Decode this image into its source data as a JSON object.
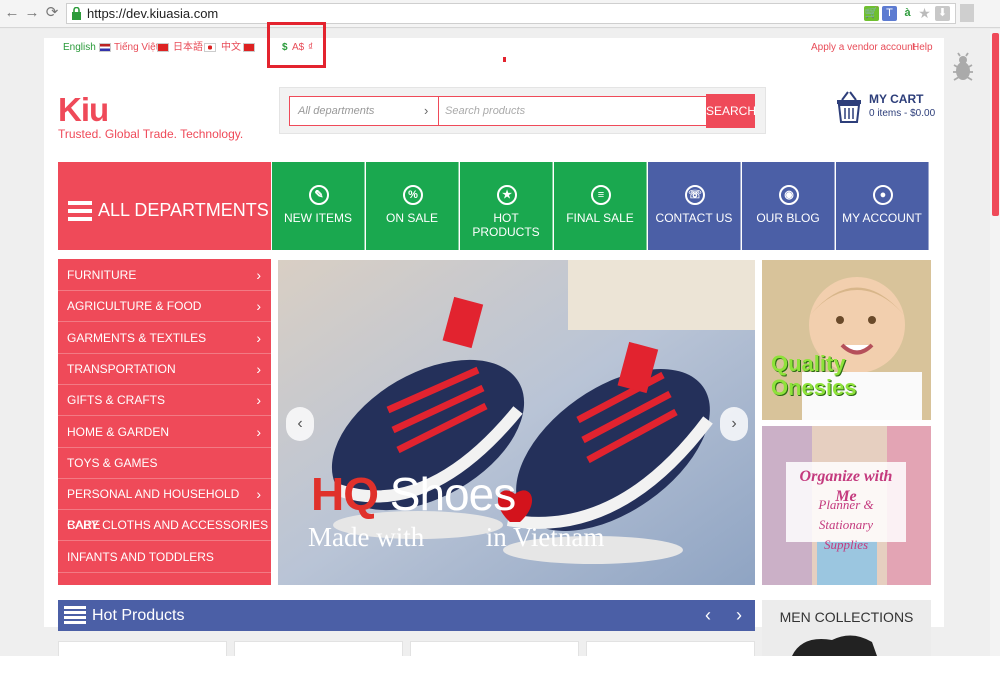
{
  "browser": {
    "url": "https://dev.kiuasia.com"
  },
  "topbar": {
    "languages": [
      {
        "label": "English",
        "color": "#2a9a3a"
      },
      {
        "label": "Tiếng Việt",
        "color": "#e84c58"
      },
      {
        "label": "日本語",
        "color": "#e84c58"
      },
      {
        "label": "中文",
        "color": "#e84c58"
      }
    ],
    "currencies": [
      {
        "label": "$",
        "color": "#2a9a3a"
      },
      {
        "label": "A$",
        "color": "#e84c58"
      },
      {
        "label": "₫",
        "color": "#e84c58"
      }
    ],
    "links": {
      "vendor": "Apply a vendor account",
      "help": "Help"
    }
  },
  "header": {
    "logo": "Kiu",
    "tagline": "Trusted. Global Trade. Technology.",
    "search": {
      "department": "All departments",
      "placeholder": "Search products",
      "button": "SEARCH"
    },
    "cart": {
      "title": "MY CART",
      "summary": "0 items - $0.00"
    }
  },
  "nav": {
    "all_departments": "ALL DEPARTMENTS",
    "tabs": [
      {
        "label": "NEW ITEMS",
        "glyph": "✎",
        "color": "#1aa84f"
      },
      {
        "label": "ON SALE",
        "glyph": "%",
        "color": "#1aa84f"
      },
      {
        "label": "HOT PRODUCTS",
        "glyph": "★",
        "color": "#1aa84f"
      },
      {
        "label": "FINAL SALE",
        "glyph": "≡",
        "color": "#1aa84f"
      },
      {
        "label": "CONTACT US",
        "glyph": "☏",
        "color": "#4b5fa6"
      },
      {
        "label": "OUR BLOG",
        "glyph": "◉",
        "color": "#4b5fa6"
      },
      {
        "label": "MY ACCOUNT",
        "glyph": "●",
        "color": "#4b5fa6"
      }
    ]
  },
  "sidebar": {
    "items": [
      {
        "label": "FURNITURE",
        "chevron": "›"
      },
      {
        "label": "AGRICULTURE & FOOD",
        "chevron": "›"
      },
      {
        "label": "GARMENTS & TEXTILES",
        "chevron": "›"
      },
      {
        "label": "TRANSPORTATION",
        "chevron": "›"
      },
      {
        "label": "GIFTS & CRAFTS",
        "chevron": "›"
      },
      {
        "label": "HOME & GARDEN",
        "chevron": "›"
      },
      {
        "label": "TOYS & GAMES",
        "chevron": ""
      },
      {
        "label": "PERSONAL AND HOUSEHOLD CARE",
        "chevron": "›"
      },
      {
        "label": "BABY CLOTHS AND ACCESSORIES",
        "chevron": ""
      },
      {
        "label": "INFANTS AND TODDLERS",
        "chevron": ""
      }
    ]
  },
  "banner": {
    "hq": "HQ",
    "shoes": "Shoes",
    "made_with": "Made with",
    "in_vietnam": "in Vietnam",
    "prev": "‹",
    "next": "›"
  },
  "promos": {
    "p1_line1": "Quality",
    "p1_line2": "Onesies",
    "p2_line1": "Organize with Me",
    "p2_line2": "Planner & Stationary",
    "p2_line3": "Supplies"
  },
  "hot_products": {
    "title": "Hot Products",
    "prev": "‹",
    "next": "›"
  },
  "men_collections": "MEN COLLECTIONS"
}
